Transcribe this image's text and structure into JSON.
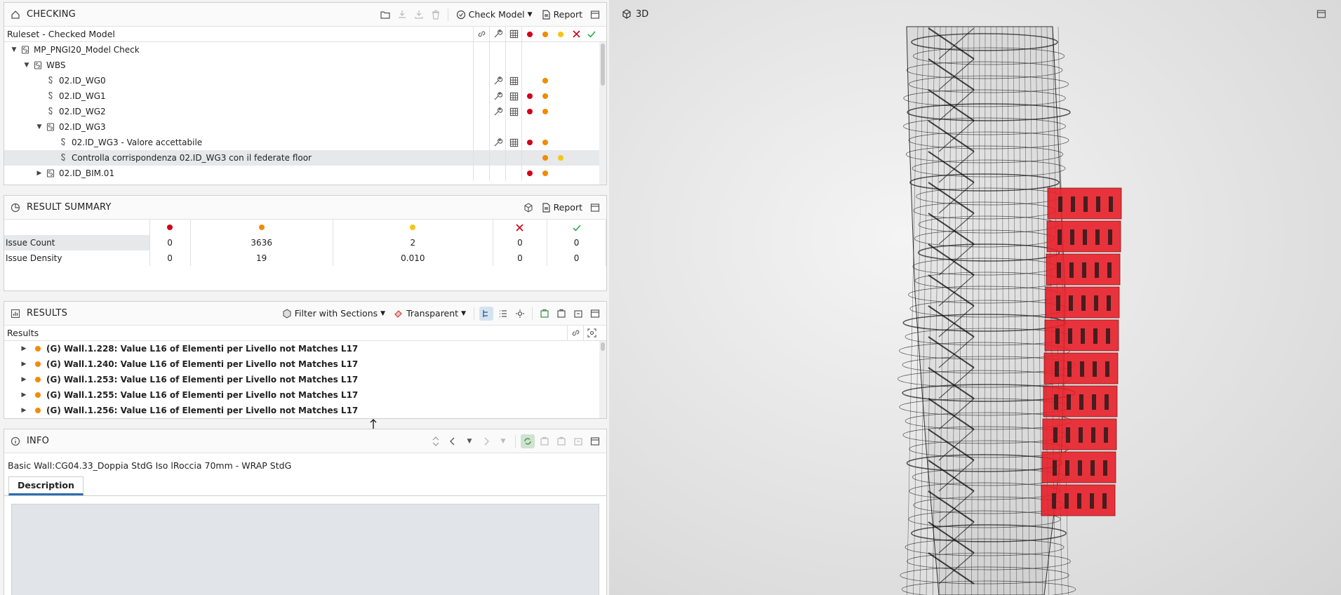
{
  "checking": {
    "title": "CHECKING",
    "check_model": "Check Model",
    "report": "Report",
    "tree_header": "Ruleset - Checked Model",
    "rows": [
      {
        "label": "MP_PNGI20_Model Check",
        "level": 0,
        "expand": "down",
        "icon": "ruleset",
        "tools": [],
        "dots": []
      },
      {
        "label": "WBS",
        "level": 1,
        "expand": "down",
        "icon": "ruleset",
        "tools": [],
        "dots": []
      },
      {
        "label": "02.ID_WG0",
        "level": 2,
        "expand": "",
        "icon": "rule",
        "tools": [
          "wrench",
          "table"
        ],
        "dots": [
          "",
          "orange"
        ]
      },
      {
        "label": "02.ID_WG1",
        "level": 2,
        "expand": "",
        "icon": "rule",
        "tools": [
          "wrench",
          "table"
        ],
        "dots": [
          "red",
          "orange"
        ]
      },
      {
        "label": "02.ID_WG2",
        "level": 2,
        "expand": "",
        "icon": "rule",
        "tools": [
          "wrench",
          "table"
        ],
        "dots": [
          "red",
          "orange"
        ]
      },
      {
        "label": "02.ID_WG3",
        "level": 2,
        "expand": "down",
        "icon": "ruleset",
        "tools": [],
        "dots": []
      },
      {
        "label": "02.ID_WG3 - Valore accettabile",
        "level": 3,
        "expand": "",
        "icon": "rule",
        "tools": [
          "wrench",
          "table"
        ],
        "dots": [
          "red",
          "orange"
        ]
      },
      {
        "label": "Controlla corrispondenza 02.ID_WG3 con il federate floor",
        "level": 3,
        "expand": "",
        "icon": "rule",
        "tools": [],
        "dots": [
          "",
          "orange",
          "yellow"
        ],
        "selected": true
      },
      {
        "label": "02.ID_BIM.01",
        "level": 2,
        "expand": "right",
        "icon": "ruleset",
        "tools": [],
        "dots": [
          "red",
          "orange"
        ]
      }
    ]
  },
  "summary": {
    "title": "RESULT SUMMARY",
    "report": "Report",
    "rows": [
      {
        "label": "Issue Count",
        "values": [
          "0",
          "3636",
          "2",
          "0",
          "0"
        ]
      },
      {
        "label": "Issue Density",
        "values": [
          "0",
          "19",
          "0.010",
          "0",
          "0"
        ]
      }
    ]
  },
  "results": {
    "title": "RESULTS",
    "filter": "Filter with Sections",
    "transparent": "Transparent",
    "header": "Results",
    "rows": [
      "(G) Wall.1.228: Value L16 of Elementi per Livello not Matches L17",
      "(G) Wall.1.240: Value L16 of Elementi per Livello not Matches L17",
      "(G) Wall.1.253: Value L16 of Elementi per Livello not Matches L17",
      "(G) Wall.1.255: Value L16 of Elementi per Livello not Matches L17",
      "(G) Wall.1.256: Value L16 of Elementi per Livello not Matches L17"
    ]
  },
  "info": {
    "title": "INFO",
    "element": "Basic Wall:CG04.33_Doppia StdG Iso lRoccia 70mm - WRAP StdG",
    "tab": "Description"
  },
  "view3d": {
    "title": "3D"
  },
  "colors": {
    "critical": "#d0021b",
    "moderate": "#f08c00",
    "low": "#f5c518",
    "rejected": "#d0021b",
    "accepted": "#2aa84a",
    "highlight": "#e8202a"
  }
}
